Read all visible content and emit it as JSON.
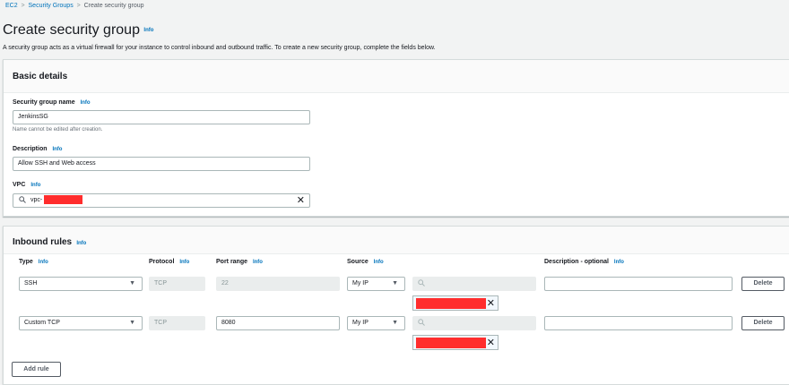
{
  "breadcrumb": {
    "items": [
      "EC2",
      "Security Groups",
      "Create security group"
    ]
  },
  "page": {
    "title": "Create security group",
    "info": "Info",
    "description": "A security group acts as a virtual firewall for your instance to control inbound and outbound traffic. To create a new security group, complete the fields below."
  },
  "basic": {
    "heading": "Basic details",
    "name_label": "Security group name",
    "name_value": "JenkinsSG",
    "name_hint": "Name cannot be edited after creation.",
    "desc_label": "Description",
    "desc_value": "Allow SSH and Web access",
    "vpc_label": "VPC",
    "vpc_value": "vpc-"
  },
  "inbound": {
    "heading": "Inbound rules",
    "col_type": "Type",
    "col_protocol": "Protocol",
    "col_port": "Port range",
    "col_source": "Source",
    "col_desc": "Description - optional",
    "rows": [
      {
        "type": "SSH",
        "protocol": "TCP",
        "port": "22",
        "source": "My IP",
        "delete": "Delete"
      },
      {
        "type": "Custom TCP",
        "protocol": "TCP",
        "port": "8080",
        "source": "My IP",
        "delete": "Delete"
      }
    ],
    "add_rule": "Add rule"
  },
  "common": {
    "info": "Info"
  }
}
